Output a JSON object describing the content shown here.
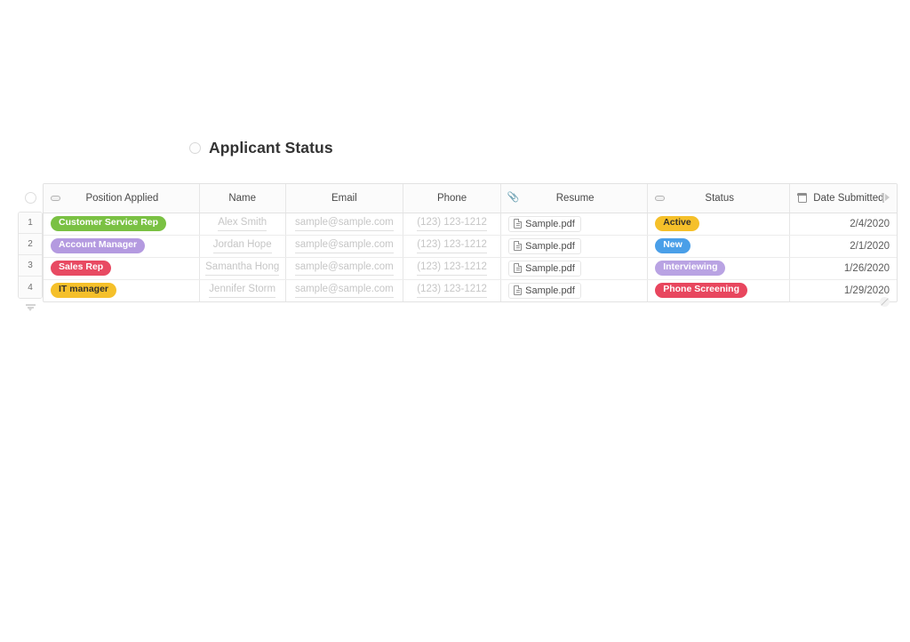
{
  "page": {
    "background": "#ffffff"
  },
  "header": {
    "bullet_icon": "circle-icon",
    "title": "Applicant Status"
  },
  "table": {
    "select_all_icon": "circle-icon",
    "collapse_icon": "collapse-rows-icon",
    "edge_expand_icon": "expand-right-icon",
    "resize_icon": "resize-grip-icon",
    "columns": [
      {
        "label": "Position Applied",
        "icon": "single-select-pill-icon",
        "align": "center"
      },
      {
        "label": "Name",
        "icon": "",
        "align": "center"
      },
      {
        "label": "Email",
        "icon": "",
        "align": "center"
      },
      {
        "label": "Phone",
        "icon": "",
        "align": "center"
      },
      {
        "label": "Resume",
        "icon": "paperclip-icon",
        "align": "center"
      },
      {
        "label": "Status",
        "icon": "single-select-pill-icon",
        "align": "center"
      },
      {
        "label": "Date Submitted",
        "icon": "calendar-icon",
        "align": "left"
      }
    ],
    "rows": [
      {
        "number": "1",
        "position": {
          "text": "Customer Service Rep",
          "bg": "#7ac143",
          "fg": "#ffffff"
        },
        "name": "Alex Smith",
        "email": "sample@sample.com",
        "phone": "(123) 123-1212",
        "resume": "Sample.pdf",
        "status": {
          "text": "Active",
          "bg": "#f5c02a",
          "fg": "#33302a"
        },
        "date": "2/4/2020"
      },
      {
        "number": "2",
        "position": {
          "text": "Account Manager",
          "bg": "#b49ae0",
          "fg": "#ffffff"
        },
        "name": "Jordan Hope",
        "email": "sample@sample.com",
        "phone": "(123) 123-1212",
        "resume": "Sample.pdf",
        "status": {
          "text": "New",
          "bg": "#4a9fe8",
          "fg": "#ffffff"
        },
        "date": "2/1/2020"
      },
      {
        "number": "3",
        "position": {
          "text": "Sales Rep",
          "bg": "#e84a62",
          "fg": "#ffffff"
        },
        "name": "Samantha Hong",
        "email": "sample@sample.com",
        "phone": "(123) 123-1212",
        "resume": "Sample.pdf",
        "status": {
          "text": "Interviewing",
          "bg": "#b9a3e3",
          "fg": "#ffffff"
        },
        "date": "1/26/2020"
      },
      {
        "number": "4",
        "position": {
          "text": "IT manager",
          "bg": "#f5c02a",
          "fg": "#33302a"
        },
        "name": "Jennifer Storm",
        "email": "sample@sample.com",
        "phone": "(123) 123-1212",
        "resume": "Sample.pdf",
        "status": {
          "text": "Phone Screening",
          "bg": "#e8465e",
          "fg": "#ffffff"
        },
        "date": "1/29/2020"
      }
    ]
  }
}
